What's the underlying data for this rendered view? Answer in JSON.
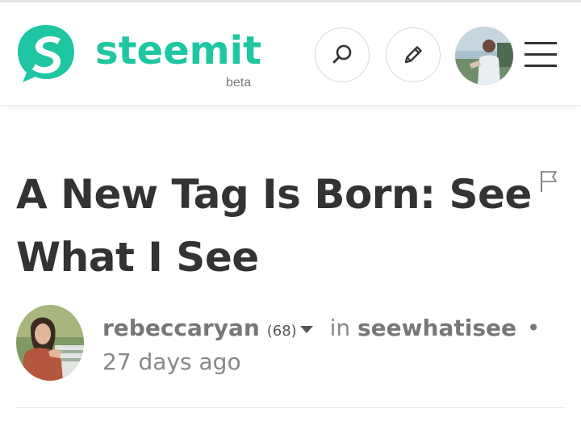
{
  "header": {
    "logo_text": "steemit",
    "beta_label": "beta",
    "brand_color": "#1ec7a1",
    "search_icon": "search-icon",
    "compose_icon": "pencil-icon",
    "menu_icon": "hamburger-menu-icon"
  },
  "post": {
    "title": "A New Tag Is Born: See What I See",
    "author": "rebeccaryan",
    "reputation": "(68)",
    "in_label": "in",
    "category": "seewhatisee",
    "separator": "•",
    "age": "27 days ago"
  }
}
